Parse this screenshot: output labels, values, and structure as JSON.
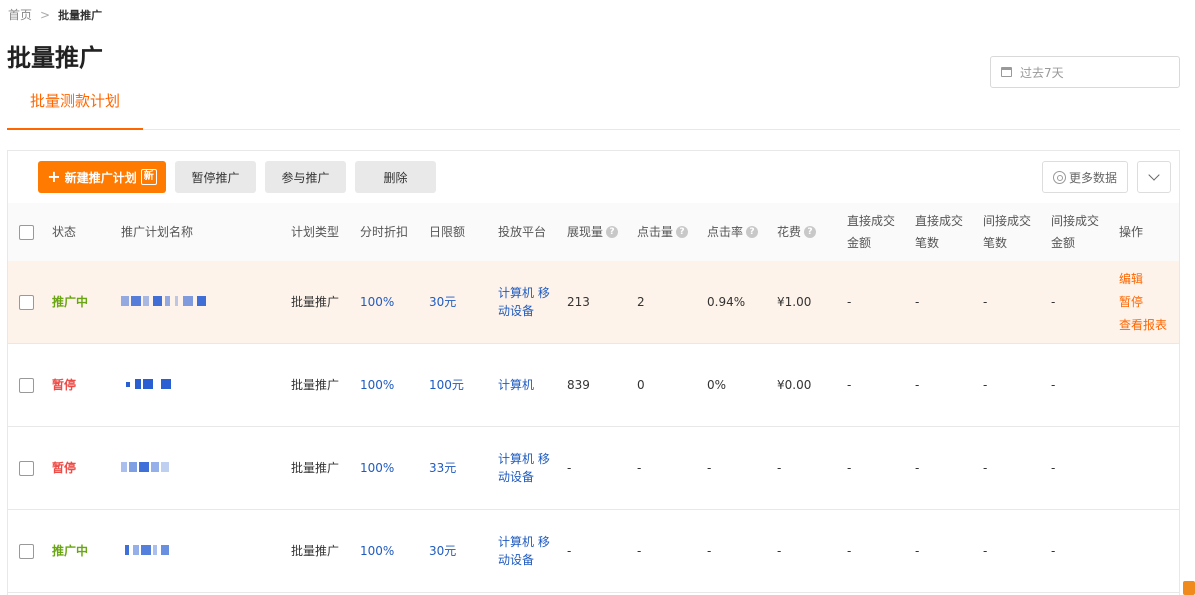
{
  "breadcrumb": {
    "home": "首页",
    "current": "批量推广"
  },
  "page_title": "批量推广",
  "date_filter": {
    "placeholder": "过去7天"
  },
  "tabs": [
    {
      "label": "批量测款计划"
    }
  ],
  "toolbar": {
    "new_plan": "新建推广计划",
    "new_badge": "新",
    "pause": "暂停推广",
    "join": "参与推广",
    "delete": "删除",
    "more_data": "更多数据"
  },
  "table": {
    "headers": {
      "status": "状态",
      "name": "推广计划名称",
      "type": "计划类型",
      "discount": "分时折扣",
      "budget": "日限额",
      "platform": "投放平台",
      "impressions": "展现量",
      "clicks": "点击量",
      "ctr": "点击率",
      "cost": "花费",
      "direct_amount": "直接成交金额",
      "direct_count": "直接成交笔数",
      "indirect_count": "间接成交笔数",
      "indirect_amount": "间接成交金额",
      "actions": "操作"
    },
    "rows": [
      {
        "status": "推广中",
        "type": "批量推广",
        "discount": "100%",
        "budget": "30元",
        "platform": "计算机 移动设备",
        "impressions": "213",
        "clicks": "2",
        "ctr": "0.94%",
        "cost": "¥1.00",
        "direct_amount": "-",
        "direct_count": "-",
        "indirect_count": "-",
        "indirect_amount": "-"
      },
      {
        "status": "暂停",
        "type": "批量推广",
        "discount": "100%",
        "budget": "100元",
        "platform": "计算机",
        "impressions": "839",
        "clicks": "0",
        "ctr": "0%",
        "cost": "¥0.00",
        "direct_amount": "-",
        "direct_count": "-",
        "indirect_count": "-",
        "indirect_amount": "-"
      },
      {
        "status": "暂停",
        "type": "批量推广",
        "discount": "100%",
        "budget": "33元",
        "platform": "计算机 移动设备",
        "impressions": "-",
        "clicks": "-",
        "ctr": "-",
        "cost": "-",
        "direct_amount": "-",
        "direct_count": "-",
        "indirect_count": "-",
        "indirect_amount": "-"
      },
      {
        "status": "推广中",
        "type": "批量推广",
        "discount": "100%",
        "budget": "30元",
        "platform": "计算机 移动设备",
        "impressions": "-",
        "clicks": "-",
        "ctr": "-",
        "cost": "-",
        "direct_amount": "-",
        "direct_count": "-",
        "indirect_count": "-",
        "indirect_amount": "-"
      }
    ],
    "row_actions": {
      "edit": "编辑",
      "pause": "暂停",
      "report": "查看报表"
    }
  },
  "colors": {
    "accent": "#ff7a00",
    "active": "#6aa513",
    "paused": "#ef4b46",
    "link": "#1f5bbf"
  }
}
